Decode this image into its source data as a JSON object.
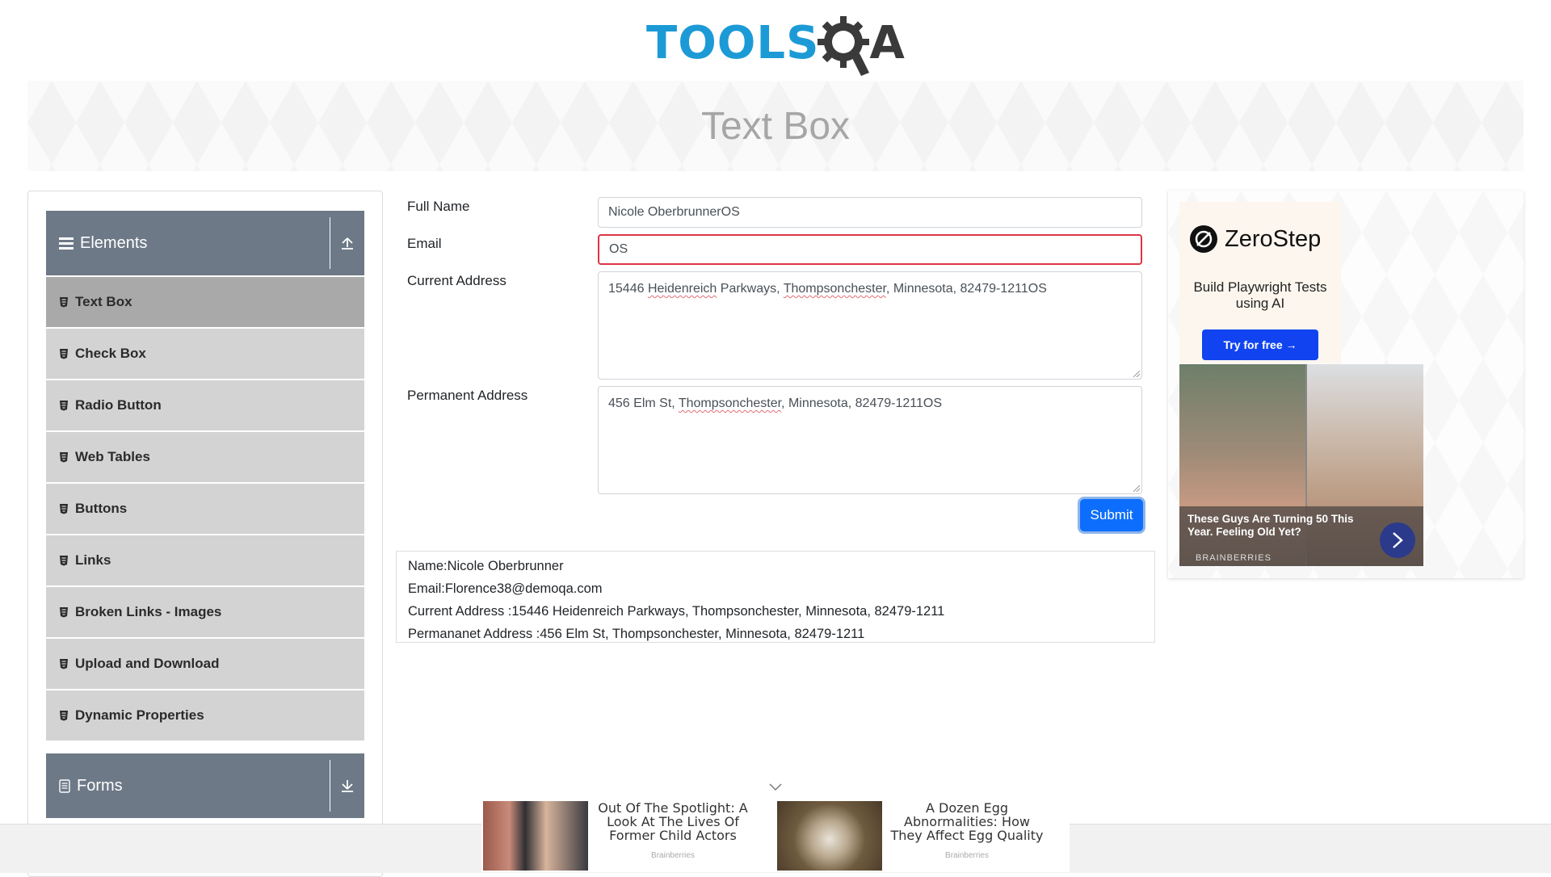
{
  "logo": {
    "part1": "TOOLS",
    "part2": "A"
  },
  "banner": {
    "title": "Text Box"
  },
  "sidebar": {
    "elements_group": {
      "label": "Elements"
    },
    "items": [
      {
        "label": "Text Box"
      },
      {
        "label": "Check Box"
      },
      {
        "label": "Radio Button"
      },
      {
        "label": "Web Tables"
      },
      {
        "label": "Buttons"
      },
      {
        "label": "Links"
      },
      {
        "label": "Broken Links - Images"
      },
      {
        "label": "Upload and Download"
      },
      {
        "label": "Dynamic Properties"
      }
    ],
    "forms_group": {
      "label": "Forms"
    }
  },
  "form": {
    "full_name_label": "Full Name",
    "full_name_value": "Nicole OberbrunnerOS",
    "email_label": "Email",
    "email_value": "OS",
    "current_address_label": "Current Address",
    "current_address": {
      "p1": "15446 ",
      "w1": "Heidenreich",
      "p2": " Parkways, ",
      "w2": "Thompsonchester",
      "p3": ", Minnesota, 82479-1211OS"
    },
    "permanent_address_label": "Permanent Address",
    "permanent_address": {
      "p1": "456 Elm St, ",
      "w1": "Thompsonchester",
      "p2": ", Minnesota, 82479-1211OS"
    },
    "submit_label": "Submit"
  },
  "output": {
    "name": "Name:Nicole Oberbrunner",
    "email": "Email:Florence38@demoqa.com",
    "current_address": "Current Address :15446 Heidenreich Parkways, Thompsonchester, Minnesota, 82479-1211",
    "permanent_address": "Permananet Address :456 Elm St, Thompsonchester, Minnesota, 82479-1211"
  },
  "ad_right": {
    "brand": "ZeroStep",
    "tagline": "Build Playwright Tests using AI",
    "cta": "Try for free →",
    "story_title": "These Guys Are Turning 50 This Year. Feeling Old Yet?",
    "story_source": "BRAINBERRIES"
  },
  "ad_bottom": {
    "story1": "Out Of The Spotlight: A Look At The Lives Of Former Child Actors",
    "story1_source": "Brainberries",
    "story2": "A Dozen Egg Abnormalities: How They Affect Egg Quality",
    "story2_source": "Brainberries"
  },
  "colors": {
    "brand_blue": "#1c9ad6",
    "header_gray": "#6d7987",
    "active_item": "#a9a9a9",
    "submit_blue": "#0d6efd",
    "error_red": "#dc3545"
  }
}
